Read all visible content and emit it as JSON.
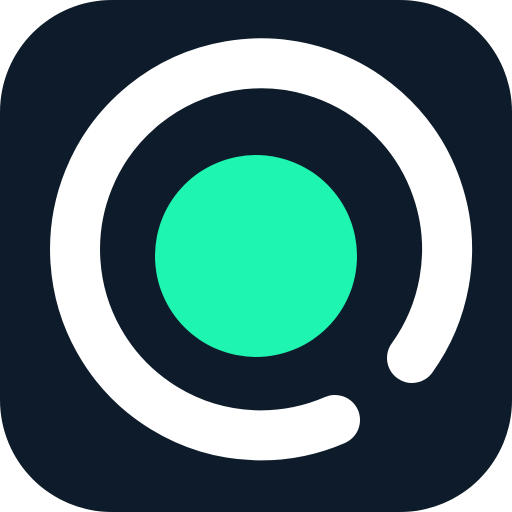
{
  "icon": {
    "name": "app-icon",
    "colors": {
      "background": "#0d1b2a",
      "ring": "#ffffff",
      "dot": "#1ef5b0"
    }
  }
}
